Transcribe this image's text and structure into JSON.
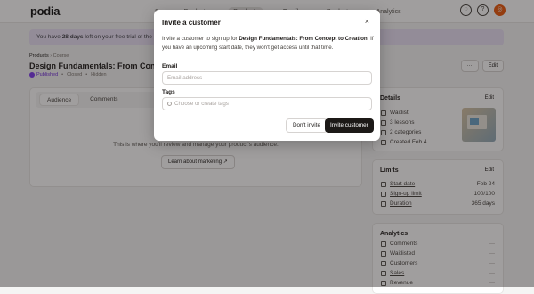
{
  "app": {
    "logo": "podia",
    "nav": [
      "S",
      "Products",
      "Products",
      "Emails",
      "Products",
      "Analytics"
    ]
  },
  "banner": {
    "prefix": "You have ",
    "days": "28 days",
    "suffix": " left on your free trial of the Shaker"
  },
  "breadcrumb": {
    "root": "Products",
    "sep": " › ",
    "current": "Course"
  },
  "product": {
    "title": "Design Fundamentals: From Concept to C",
    "status": "Published",
    "closed": "Closed",
    "hidden": "Hidden",
    "more": "···",
    "edit": "Edit"
  },
  "main": {
    "tabs": [
      {
        "label": "Audience"
      },
      {
        "label": "Comments"
      }
    ],
    "empty_text": "This is where you'll review and manage your product's audience.",
    "marketing_btn": "Learn about marketing ↗"
  },
  "details": {
    "title": "Details",
    "edit": "Edit",
    "rows": [
      "Waitlist",
      "3 lessons",
      "2 categories",
      "Created Feb 4"
    ]
  },
  "limits": {
    "title": "Limits",
    "edit": "Edit",
    "rows": [
      {
        "label": "Start date",
        "value": "Feb 24"
      },
      {
        "label": "Sign-up limit",
        "value": "100/100"
      },
      {
        "label": "Duration",
        "value": "365 days"
      }
    ]
  },
  "analytics": {
    "title": "Analytics",
    "rows": [
      {
        "label": "Comments",
        "value": "—"
      },
      {
        "label": "Waitlisted",
        "value": "—"
      },
      {
        "label": "Customers",
        "value": "—"
      },
      {
        "label": "Sales",
        "value": "—"
      },
      {
        "label": "Revenue",
        "value": "—"
      }
    ]
  },
  "modal": {
    "title": "Invite a customer",
    "close": "×",
    "desc_prefix": "Invite a customer to sign up for ",
    "desc_product": "Design Fundamentals: From Concept to Creation",
    "desc_suffix": ". If you have an upcoming start date, they won't get access until that time.",
    "email_label": "Email",
    "email_placeholder": "Email address",
    "tags_label": "Tags",
    "tags_placeholder": "Choose or create tags",
    "cancel": "Don't invite",
    "submit": "Invite customer"
  }
}
